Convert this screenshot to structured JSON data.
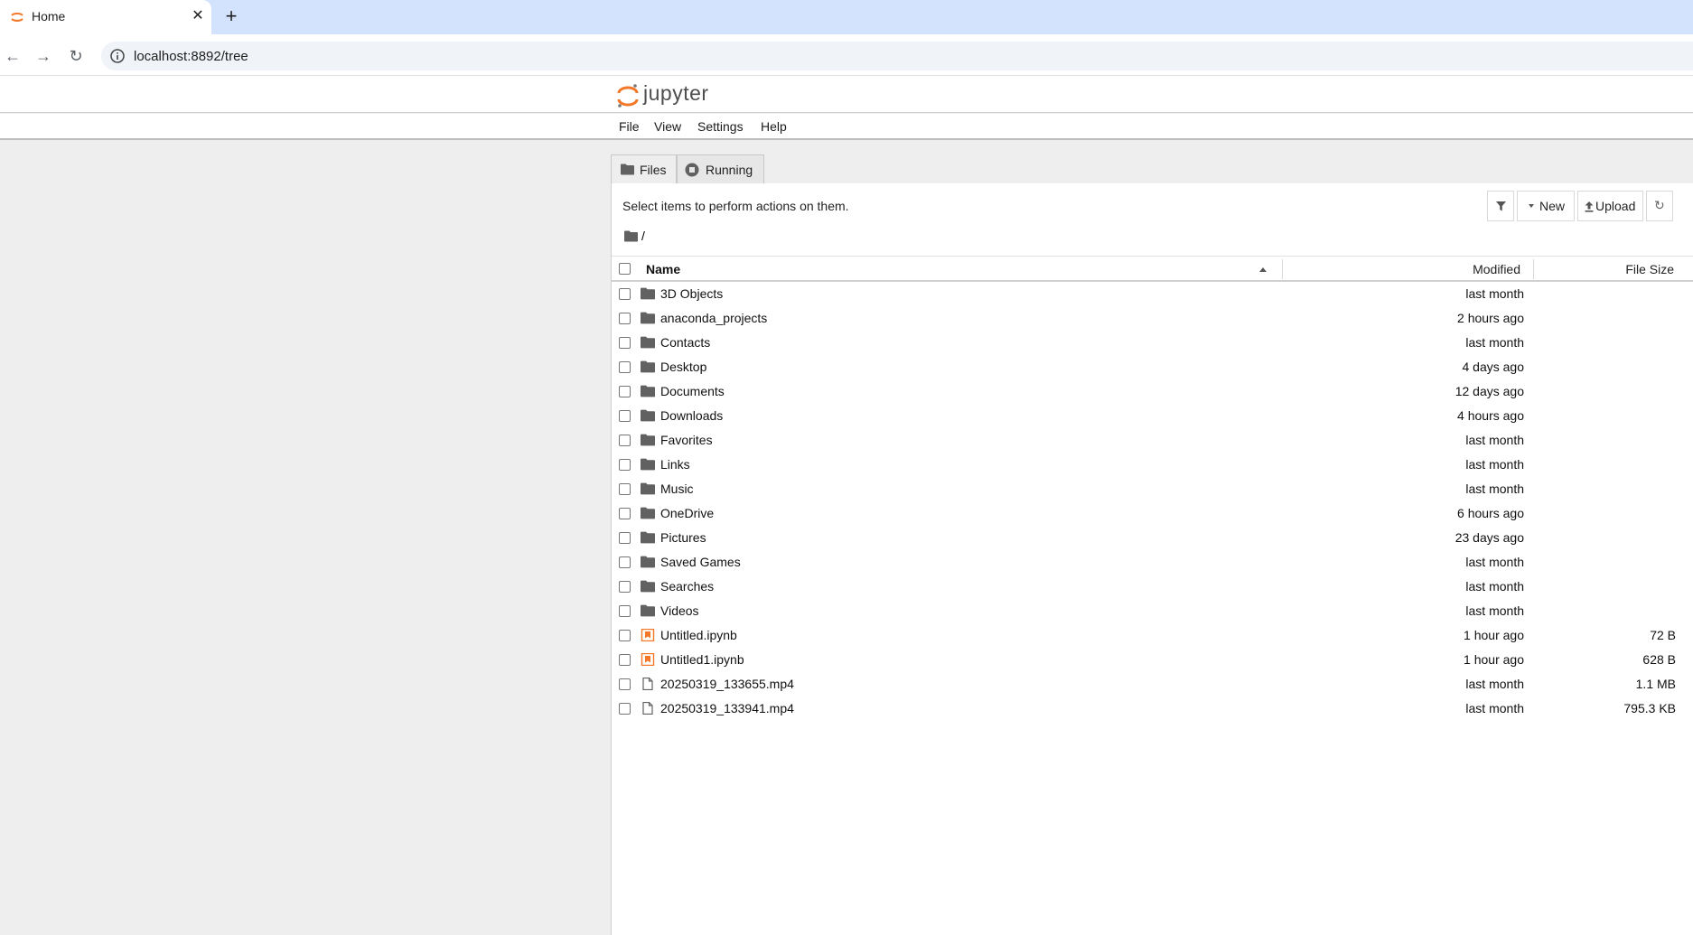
{
  "browser": {
    "tab_title": "Home",
    "url": "localhost:8892/tree"
  },
  "header": {
    "logo_text": "jupyter"
  },
  "menu": [
    {
      "label": "File"
    },
    {
      "label": "View"
    },
    {
      "label": "Settings"
    },
    {
      "label": "Help"
    }
  ],
  "tabs": [
    {
      "label": "Files",
      "active": true
    },
    {
      "label": "Running",
      "active": false
    }
  ],
  "toolbar": {
    "hint": "Select items to perform actions on them.",
    "new_label": "New",
    "upload_label": "Upload"
  },
  "breadcrumb": {
    "path": "/"
  },
  "columns": {
    "name": "Name",
    "modified": "Modified",
    "size": "File Size"
  },
  "files": [
    {
      "name": "3D Objects",
      "type": "folder",
      "modified": "last month",
      "size": ""
    },
    {
      "name": "anaconda_projects",
      "type": "folder",
      "modified": "2 hours ago",
      "size": ""
    },
    {
      "name": "Contacts",
      "type": "folder",
      "modified": "last month",
      "size": ""
    },
    {
      "name": "Desktop",
      "type": "folder",
      "modified": "4 days ago",
      "size": ""
    },
    {
      "name": "Documents",
      "type": "folder",
      "modified": "12 days ago",
      "size": ""
    },
    {
      "name": "Downloads",
      "type": "folder",
      "modified": "4 hours ago",
      "size": ""
    },
    {
      "name": "Favorites",
      "type": "folder",
      "modified": "last month",
      "size": ""
    },
    {
      "name": "Links",
      "type": "folder",
      "modified": "last month",
      "size": ""
    },
    {
      "name": "Music",
      "type": "folder",
      "modified": "last month",
      "size": ""
    },
    {
      "name": "OneDrive",
      "type": "folder",
      "modified": "6 hours ago",
      "size": ""
    },
    {
      "name": "Pictures",
      "type": "folder",
      "modified": "23 days ago",
      "size": ""
    },
    {
      "name": "Saved Games",
      "type": "folder",
      "modified": "last month",
      "size": ""
    },
    {
      "name": "Searches",
      "type": "folder",
      "modified": "last month",
      "size": ""
    },
    {
      "name": "Videos",
      "type": "folder",
      "modified": "last month",
      "size": ""
    },
    {
      "name": "Untitled.ipynb",
      "type": "notebook",
      "modified": "1 hour ago",
      "size": "72 B"
    },
    {
      "name": "Untitled1.ipynb",
      "type": "notebook",
      "modified": "1 hour ago",
      "size": "628 B"
    },
    {
      "name": "20250319_133655.mp4",
      "type": "file",
      "modified": "last month",
      "size": "1.1 MB"
    },
    {
      "name": "20250319_133941.mp4",
      "type": "file",
      "modified": "last month",
      "size": "795.3 KB"
    }
  ],
  "colors": {
    "jupyter_orange": "#f37726",
    "folder_gray": "#616161"
  }
}
